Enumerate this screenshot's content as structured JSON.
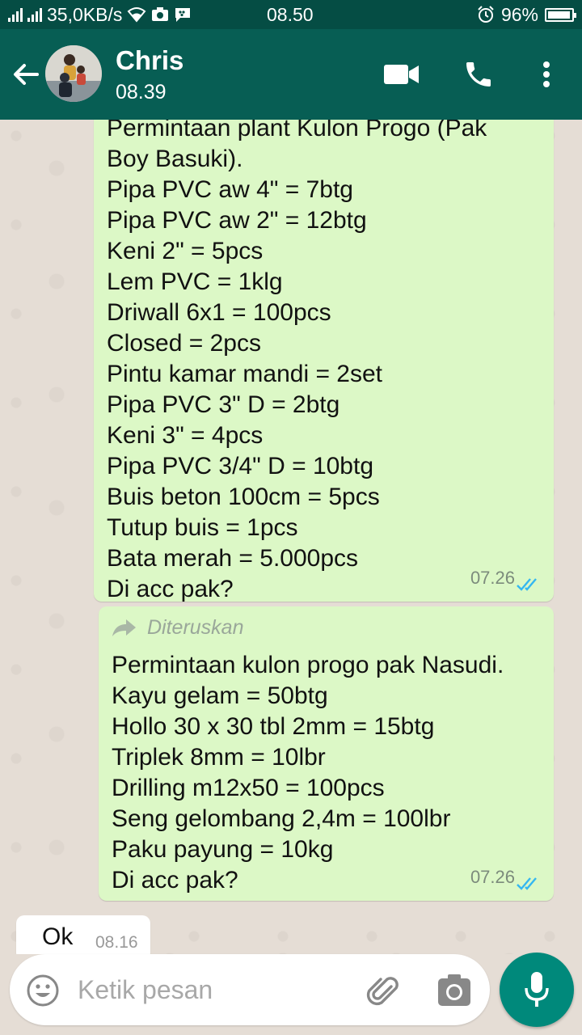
{
  "status_bar": {
    "network_speed": "35,0KB/s",
    "clock": "08.50",
    "battery_level": "96%",
    "battery_fraction": 0.96
  },
  "header": {
    "contact_name": "Chris",
    "contact_status": "08.39",
    "icons": [
      "back-arrow-icon",
      "video-call-icon",
      "phone-icon",
      "more-options-icon"
    ]
  },
  "messages": [
    {
      "lines": [
        "Permintaan plant Kulon Progo (Pak",
        "Boy Basuki).",
        "Pipa PVC aw 4\" = 7btg",
        "Pipa PVC aw 2\" = 12btg",
        "Keni 2\" = 5pcs",
        "Lem PVC = 1klg",
        "Driwall 6x1 = 100pcs",
        "Closed = 2pcs",
        "Pintu kamar mandi = 2set",
        "Pipa PVC 3\" D = 2btg",
        "Keni 3\" = 4pcs",
        "Pipa PVC 3/4\" D = 10btg",
        "Buis beton 100cm = 5pcs",
        "Tutup buis = 1pcs",
        "Bata merah = 5.000pcs",
        "Di acc pak?"
      ],
      "time": "07.26",
      "status": "read"
    },
    {
      "forwarded_label": "Diteruskan",
      "lines": [
        "Permintaan kulon progo pak Nasudi.",
        "Kayu gelam = 50btg",
        "Hollo 30 x 30 tbl 2mm = 15btg",
        "Triplek 8mm = 10lbr",
        "Drilling m12x50 = 100pcs",
        "Seng gelombang 2,4m = 100lbr",
        "Paku payung = 10kg",
        "Di acc pak?"
      ],
      "time": "07.26",
      "status": "read"
    },
    {
      "text": "Ok",
      "time": "08.16",
      "direction": "incoming"
    }
  ],
  "composer": {
    "placeholder": "Ketik pesan"
  },
  "colors": {
    "header": "#075e54",
    "status_bar": "#054d44",
    "outgoing_bubble": "#dcf8c6",
    "read_ticks": "#34b7f1",
    "mic_button": "#00897b"
  }
}
